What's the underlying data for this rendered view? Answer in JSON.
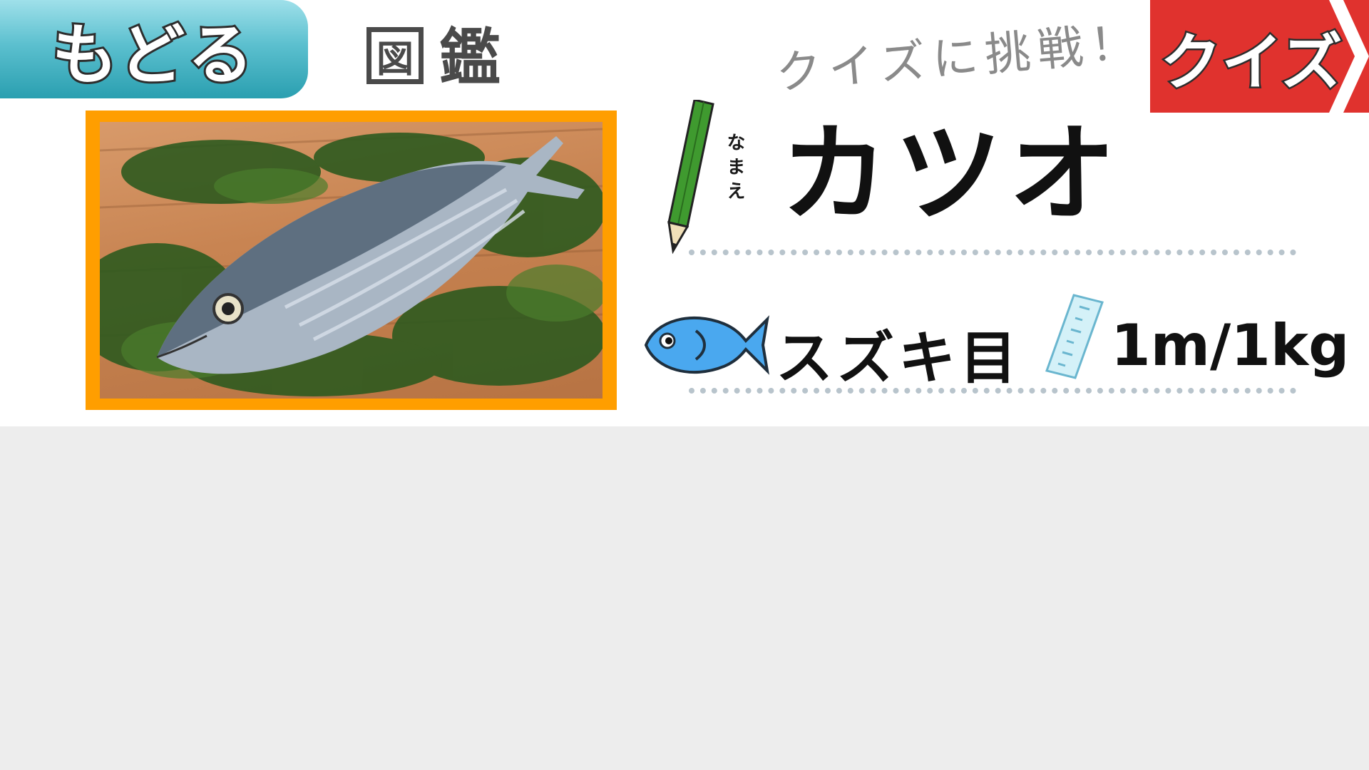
{
  "header": {
    "back_label": "もどる",
    "title_boxed": "図",
    "title_rest": "鑑",
    "quiz_prompt": "クイズに挑戦！",
    "quiz_button_label": "クイズ"
  },
  "entry": {
    "furigana": "なまえ",
    "name": "カツオ",
    "order": "スズキ目",
    "size": "1m/1kg",
    "photo_subject": "skipjack tuna on cedar leaves"
  },
  "colors": {
    "back_button": "#2a9fb0",
    "quiz_button": "#e0322e",
    "photo_frame": "#ff9e00",
    "fish_icon": "#4aa8ef",
    "bottom_panel": "#ededed"
  },
  "icons": [
    "pencil-icon",
    "fish-icon",
    "ruler-icon",
    "chevron-right-icon"
  ]
}
